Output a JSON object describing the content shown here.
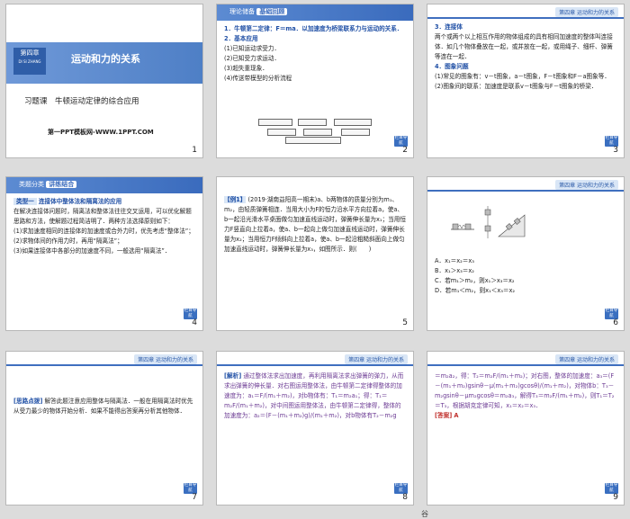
{
  "slides": [
    {
      "number": "1",
      "chapter": "第四章",
      "chapter_en": "DI SI ZHANG",
      "title": "运动和力的关系",
      "subtitle": "习题课　牛顿运动定律的综合应用",
      "link": "第一PPT模板网-WWW.1PPT.COM"
    },
    {
      "number": "2",
      "header": "理论储备",
      "header_tag": "基础回顾",
      "chapter": "第四章 运动和力的关系",
      "lines": [
        "1．牛顿第二定律：F＝ma．以加速度为桥梁联系力与运动的关系．",
        "2．基本应用",
        "(1)已知运动求受力．",
        "(2)已知受力求运动．",
        "(3)超失重现象．",
        "(4)传送带模型的分析流程"
      ],
      "back": "栏目导航"
    },
    {
      "number": "3",
      "chapter": "第四章 运动和力的关系",
      "lines": [
        "3．连接体",
        "两个或两个以上相互作用的物体组成的具有相同加速度的整体叫连接体．如几个物体叠放在一起，或并放在一起，或用绳子、细杆、弹簧等连在一起．",
        "4．图象问题",
        "(1)常见的图象有：v－t图象，a－t图象，F－t图象和F－a图象等．",
        "(2)图象间的联系：加速度是联系v－t图象与F－t图象的桥梁．"
      ],
      "back": "栏目导航"
    },
    {
      "number": "4",
      "header": "类题分类",
      "header_tag": "讲练结合",
      "chapter": "第四章 运动和力的关系",
      "type_label": "类型一",
      "type_title": "连接体中整体法和隔离法的应用",
      "lines": [
        "在解决连接体问题时，隔离法和整体法往往交叉运用，可以优化解题思路和方法，使解题过程简洁明了．两种方法选择原则如下：",
        "(1)求加速度相同的连接体的加速度或合外力时，优先考虑“整体法”；",
        "(2)求物体间的作用力时，再用“隔离法”；",
        "(3)如果连接体中各部分的加速度不同，一般选用“隔离法”．"
      ],
      "back": "栏目导航"
    },
    {
      "number": "5",
      "example": "【例1】",
      "text": "(2019·湖南益阳高一期末)a、b两物体的质量分别为m₁、m₂，由轻质弹簧相连．当用大小为F的恒力沿水平方向拉着a，使a、b一起沿光滑水平桌面做匀加速直线运动时，弹簧伸长量为x₁；当用恒力F竖直向上拉着a，使a、b一起向上做匀加速直线运动时，弹簧伸长量为x₂；当用恒力F倾斜向上拉着a，使a、b一起沿粗糙斜面向上做匀加速直线运动时，弹簧伸长量为x₃，如图所示．则(　　)"
    },
    {
      "number": "6",
      "chapter": "第四章 运动和力的关系",
      "options": [
        "A．x₁＝x₂＝x₃",
        "B．x₁＞x₃＝x₂",
        "C．若m₁＞m₂，则x₁＞x₃＝x₂",
        "D．若m₁＜m₂，则x₁＜x₃＝x₂"
      ],
      "back": "栏目导航"
    },
    {
      "number": "7",
      "chapter": "第四章 运动和力的关系",
      "label": "[思路点拨]",
      "text": "解答此题注意应用整体与隔离法．一般在用隔离法时优先从受力最少的物体开始分析．如果不能得出答案再分析其他物体．",
      "back": "栏目导航"
    },
    {
      "number": "8",
      "chapter": "第四章 运动和力的关系",
      "label": "[解析]",
      "text": "通过整体法求出加速度，再利用隔离法求出弹簧的弹力，从而求出弹簧的伸长量．对右图运用整体法，由牛顿第二定律得整体的加速度为：a₁＝F/(m₁＋m₂)，对b物体有：T₁＝m₂a₁；得：T₁＝m₂F/(m₁＋m₂)，对中间图运用整体法，由牛顿第二定律得，整体的加速度为：a₂＝(F－(m₁＋m₂)g)/(m₁＋m₂)，对b物体有T₂－m₂g",
      "back": "栏目导航"
    },
    {
      "number": "9",
      "chapter": "第四章 运动和力的关系",
      "text": "＝m₂a₂，得：T₂＝m₂F/(m₁＋m₂)；对右图，整体的加速度：a₃＝(F－(m₁＋m₂)gsinθ－μ(m₁＋m₂)gcosθ)/(m₁＋m₂)，对物体b：T₃－m₂gsinθ－μm₂gcosθ＝m₂a₃，解得T₃＝m₂F/(m₁＋m₂)，则T₁＝T₂＝T₃，根据胡克定律可知，x₁＝x₂＝x₃．",
      "answer_label": "[答案]",
      "answer": "A",
      "back": "栏目导航"
    }
  ],
  "footer_partial": "谷"
}
